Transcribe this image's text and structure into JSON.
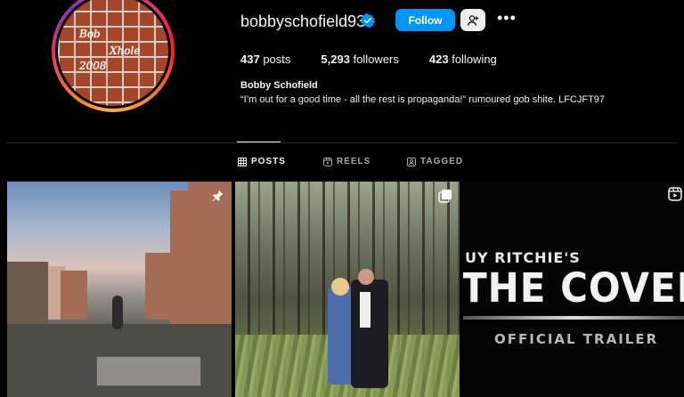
{
  "profile": {
    "username": "bobbyschofield93",
    "full_name": "Bobby Schofield",
    "bio": "“I’m out for a good time - all the rest is propaganda!” rumoured gob shite. LFCJFT97",
    "follow_label": "Follow",
    "avatar_text": [
      "Bob",
      "Xhole",
      "2008"
    ],
    "verified_color": "#0095f6"
  },
  "stats": {
    "posts_count": "437",
    "posts_label": "posts",
    "followers_count": "5,293",
    "followers_label": "followers",
    "following_count": "423",
    "following_label": "following"
  },
  "tabs": [
    {
      "label": "POSTS",
      "icon": "grid-icon",
      "active": true
    },
    {
      "label": "REELS",
      "icon": "reels-icon",
      "active": false
    },
    {
      "label": "TAGGED",
      "icon": "tagged-icon",
      "active": false
    }
  ],
  "posts": [
    {
      "badge": "pin-icon"
    },
    {
      "badge": "carousel-icon"
    },
    {
      "badge": "reels-icon",
      "text_lines": [
        "UY RITCHIE'S",
        "THE COVENAN",
        "OFFICIAL TRAILER"
      ]
    }
  ],
  "colors": {
    "accent": "#0095f6",
    "background": "#000000",
    "text": "#f5f5f5"
  }
}
